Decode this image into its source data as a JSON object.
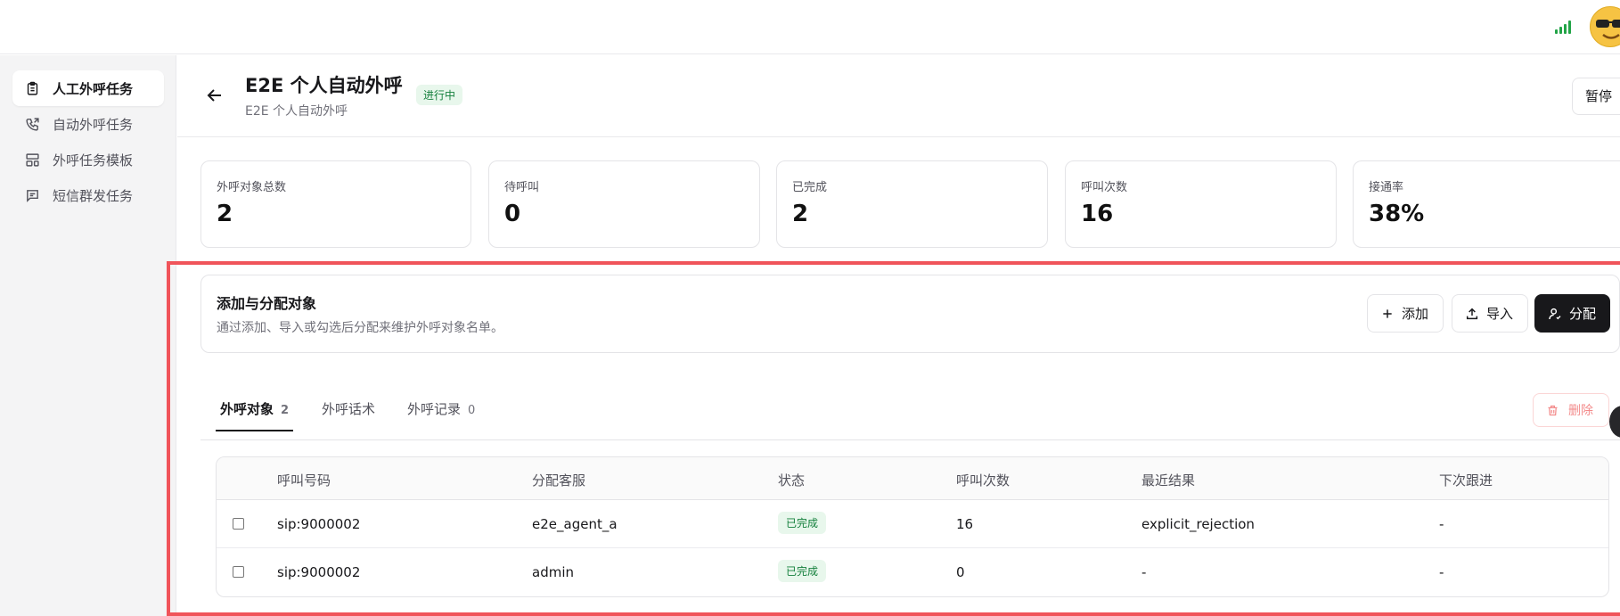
{
  "topbar": {
    "signal_icon": "signal-bars-icon",
    "avatar_icon": "sunglasses-emoji-avatar"
  },
  "sidebar": {
    "items": [
      {
        "label": "人工外呼任务",
        "icon": "clipboard-icon",
        "active": true
      },
      {
        "label": "自动外呼任务",
        "icon": "phone-call-icon",
        "active": false
      },
      {
        "label": "外呼任务模板",
        "icon": "layout-template-icon",
        "active": false
      },
      {
        "label": "短信群发任务",
        "icon": "message-icon",
        "active": false
      }
    ]
  },
  "header": {
    "title": "E2E 个人自动外呼",
    "subtitle": "E2E 个人自动外呼",
    "status_badge": "进行中",
    "pause_label": "暂停"
  },
  "stats": [
    {
      "label": "外呼对象总数",
      "value": "2"
    },
    {
      "label": "待呼叫",
      "value": "0"
    },
    {
      "label": "已完成",
      "value": "2"
    },
    {
      "label": "呼叫次数",
      "value": "16"
    },
    {
      "label": "接通率",
      "value": "38%"
    }
  ],
  "panel": {
    "title": "添加与分配对象",
    "description": "通过添加、导入或勾选后分配来维护外呼对象名单。",
    "add_label": "添加",
    "import_label": "导入",
    "assign_label": "分配"
  },
  "tabs": [
    {
      "label": "外呼对象",
      "count": "2"
    },
    {
      "label": "外呼话术",
      "count": ""
    },
    {
      "label": "外呼记录",
      "count": "0"
    }
  ],
  "delete_label": "删除",
  "table": {
    "columns": [
      "呼叫号码",
      "分配客服",
      "状态",
      "呼叫次数",
      "最近结果",
      "下次跟进"
    ],
    "rows": [
      {
        "number": "sip:9000002",
        "agent": "e2e_agent_a",
        "status": "已完成",
        "calls": "16",
        "result": "explicit_rejection",
        "next": "-"
      },
      {
        "number": "sip:9000002",
        "agent": "admin",
        "status": "已完成",
        "calls": "0",
        "result": "-",
        "next": "-"
      }
    ]
  },
  "colors": {
    "accent_dark": "#18181b",
    "success": "#15803d",
    "highlight_border": "#f0545a",
    "danger": "#f38b8b"
  }
}
